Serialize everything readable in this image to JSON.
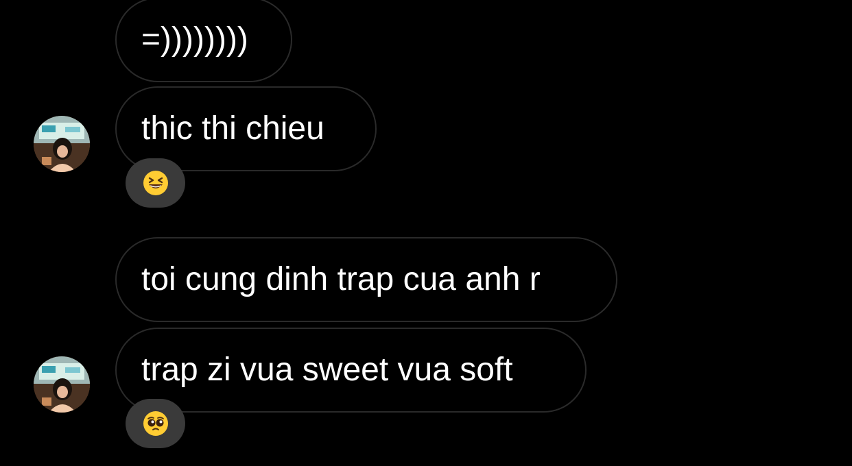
{
  "conversation": {
    "messages": [
      {
        "text": "=))))))))"
      },
      {
        "text": "thic thi chieu",
        "reaction_icon": "grinning-squinting-face-icon"
      },
      {
        "text": "toi cung dinh trap cua anh r"
      },
      {
        "text": "trap zi vua sweet vua soft",
        "reaction_icon": "pleading-face-icon"
      }
    ]
  },
  "colors": {
    "background": "#000000",
    "bubble_border": "#2a2a2a",
    "text": "#ffffff",
    "reaction_pill": "#3a3a3a"
  }
}
